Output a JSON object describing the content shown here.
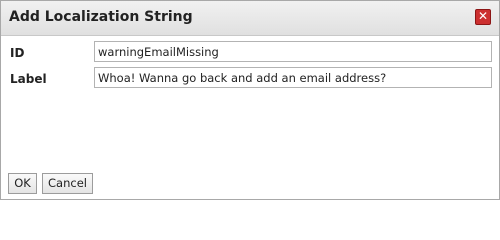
{
  "dialog": {
    "title": "Add Localization String",
    "close_icon": "close-icon"
  },
  "fields": {
    "id": {
      "label": "ID",
      "value": "warningEmailMissing"
    },
    "label": {
      "label": "Label",
      "value": "Whoa! Wanna go back and add an email address?"
    }
  },
  "buttons": {
    "ok": "OK",
    "cancel": "Cancel"
  },
  "colors": {
    "close_button": "#cc2f2f",
    "titlebar": "#e8e8e8"
  }
}
